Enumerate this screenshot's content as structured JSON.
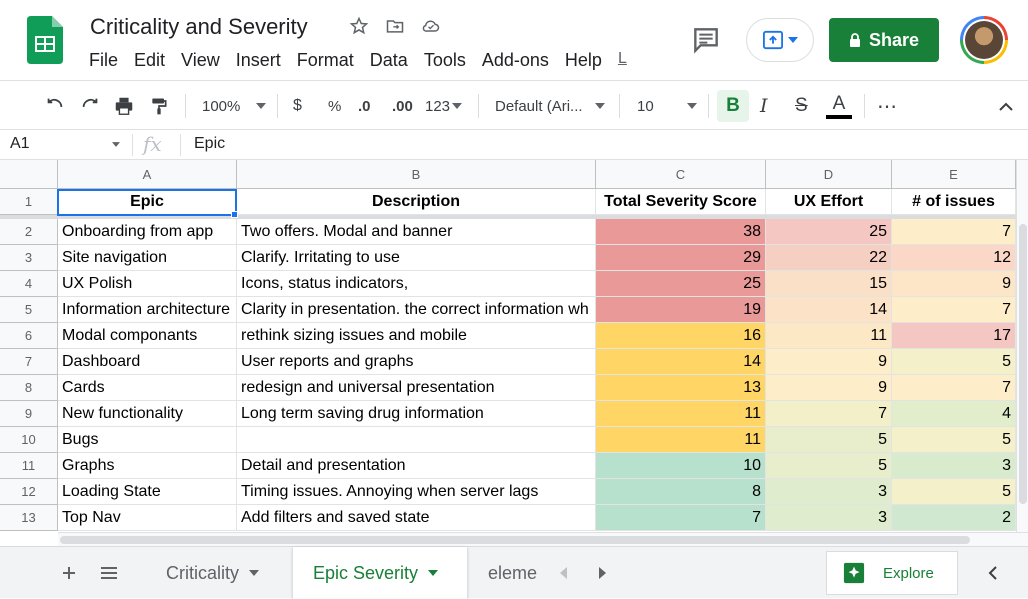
{
  "app": {
    "title": "Criticality and Severity",
    "menu": [
      "File",
      "Edit",
      "View",
      "Insert",
      "Format",
      "Data",
      "Tools",
      "Add-ons",
      "Help"
    ],
    "menu_last": "L",
    "share_label": "Share"
  },
  "toolbar": {
    "zoom": "100%",
    "currency": "$",
    "percent": "%",
    "dec_decrease": ".0",
    "dec_increase": ".00",
    "more_formats": "123",
    "font": "Default (Ari...",
    "font_size": "10",
    "bold": "B",
    "italic": "I",
    "strike": "S",
    "text_color": "A",
    "more": "⋯"
  },
  "formula_bar": {
    "cell_ref": "A1",
    "fx": "fx",
    "value": "Epic"
  },
  "sheet": {
    "columns": [
      "A",
      "B",
      "C",
      "D",
      "E"
    ],
    "rows": [
      {
        "n": "1",
        "cells": [
          "Epic",
          "Description",
          "Total Severity Score",
          "UX Effort",
          "# of issues"
        ]
      },
      {
        "n": "2",
        "cells": [
          "Onboarding from app",
          "Two offers. Modal and banner",
          "38",
          "25",
          "7"
        ]
      },
      {
        "n": "3",
        "cells": [
          "Site navigation",
          "Clarify. Irritating to use",
          "29",
          "22",
          "12"
        ]
      },
      {
        "n": "4",
        "cells": [
          "UX Polish",
          "Icons, status indicators,",
          "25",
          "15",
          "9"
        ]
      },
      {
        "n": "5",
        "cells": [
          "Information architecture",
          "Clarity in presentation. the correct information wh",
          "19",
          "14",
          "7"
        ]
      },
      {
        "n": "6",
        "cells": [
          "Modal componants",
          "rethink sizing issues and mobile",
          "16",
          "11",
          "17"
        ]
      },
      {
        "n": "7",
        "cells": [
          "Dashboard",
          "User reports and graphs",
          "14",
          "9",
          "5"
        ]
      },
      {
        "n": "8",
        "cells": [
          "Cards",
          "redesign and universal presentation",
          "13",
          "9",
          "7"
        ]
      },
      {
        "n": "9",
        "cells": [
          "New functionality",
          "Long term saving drug information",
          "11",
          "7",
          "4"
        ]
      },
      {
        "n": "10",
        "cells": [
          "Bugs",
          "",
          "11",
          "5",
          "5"
        ]
      },
      {
        "n": "11",
        "cells": [
          "Graphs",
          "Detail and presentation",
          "10",
          "5",
          "3"
        ]
      },
      {
        "n": "12",
        "cells": [
          "Loading State",
          "Timing issues. Annoying when server lags",
          "8",
          "3",
          "5"
        ]
      },
      {
        "n": "13",
        "cells": [
          "Top Nav",
          "Add filters and saved state",
          "7",
          "3",
          "2"
        ]
      }
    ],
    "colors": {
      "C": [
        "#ea9999",
        "#ea9999",
        "#ea9999",
        "#ea9999",
        "#ffd666",
        "#ffd666",
        "#ffd666",
        "#ffd666",
        "#ffd666",
        "#b7e1cd",
        "#b7e1cd",
        "#b7e1cd"
      ],
      "D": [
        "#f4c7c3",
        "#f6cfc3",
        "#fbe0c8",
        "#fce3c8",
        "#fde8c6",
        "#fdedc8",
        "#fdedc8",
        "#f3efc8",
        "#e8eecb",
        "#e8eecb",
        "#dfeccd",
        "#dfeccd"
      ],
      "E": [
        "#fdeec9",
        "#fbd7c8",
        "#fde6c7",
        "#fdeec9",
        "#f4c7c3",
        "#f3f0ca",
        "#fdeec9",
        "#e2edcc",
        "#f3f0ca",
        "#d9ebcd",
        "#f3f0ca",
        "#d0e8cf"
      ]
    }
  },
  "tabs": {
    "sheet1": "Criticality",
    "sheet2": "Epic Severity",
    "sheet3": "eleme",
    "explore": "Explore"
  }
}
